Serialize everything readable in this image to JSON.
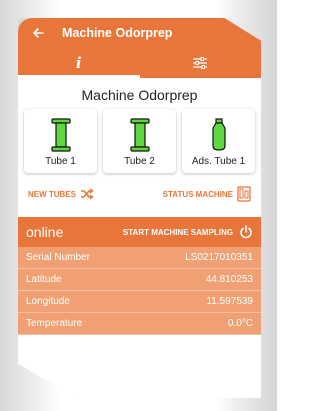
{
  "appbar": {
    "title": "Machine Odorprep"
  },
  "machine": {
    "name": "Machine Odorprep"
  },
  "tubes": [
    {
      "label": "Tube 1",
      "color": "#5ed83f"
    },
    {
      "label": "Tube 2",
      "color": "#5ed83f"
    },
    {
      "label": "Ads. Tube 1",
      "color": "#5ed83f"
    }
  ],
  "actions": {
    "new_tubes": "NEW TUBES",
    "status_machine": "STATUS MACHINE"
  },
  "status": {
    "state": "online",
    "start_sampling": "START MACHINE SAMPLING"
  },
  "info": {
    "serial_number": {
      "label": "Serial Number",
      "value": "LS0217010351"
    },
    "latitude": {
      "label": "Latitude",
      "value": "44.810253"
    },
    "longitude": {
      "label": "Longitude",
      "value": "11.597539"
    },
    "temperature": {
      "label": "Temperature",
      "value": "0.0°C"
    }
  },
  "colors": {
    "accent": "#e8763a",
    "info_bg": "#f0a073",
    "tube_green": "#5ed83f"
  },
  "icons": [
    "back-arrow-icon",
    "info-icon",
    "settings-sliders-icon",
    "shuffle-icon",
    "status-machine-icon",
    "power-icon"
  ]
}
